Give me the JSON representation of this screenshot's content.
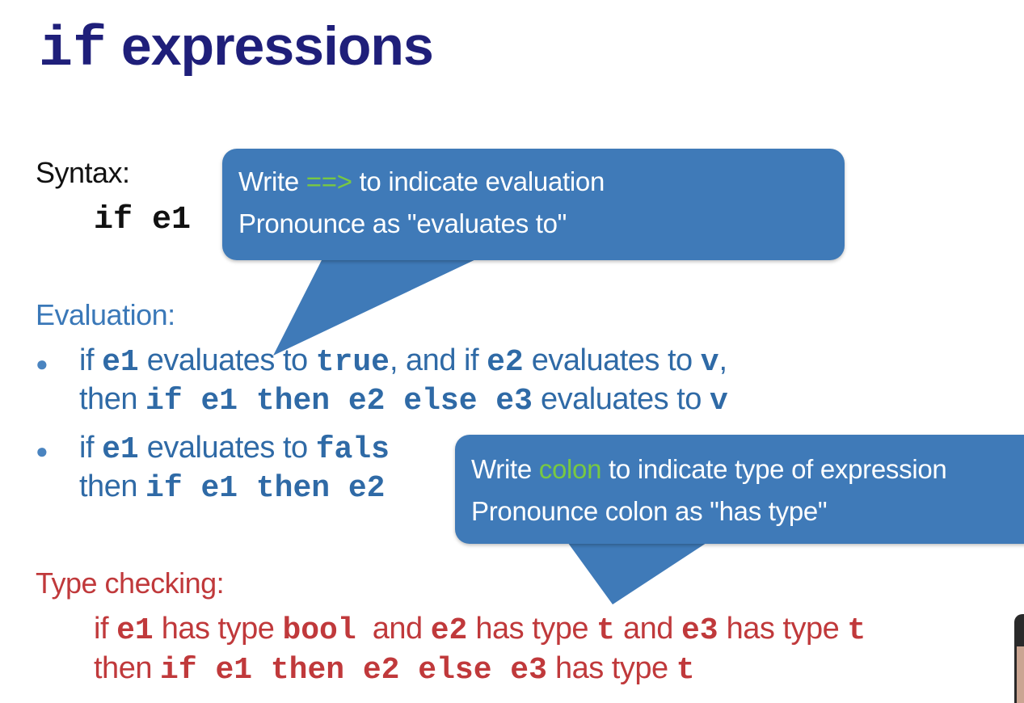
{
  "title": {
    "keyword": "if",
    "rest": " expressions"
  },
  "syntax": {
    "heading": "Syntax:",
    "code": "if e1"
  },
  "evaluation": {
    "heading": "Evaluation:",
    "bullet1": {
      "a1": "if ",
      "c1": "e1",
      "a2": " evaluates to ",
      "c2": "true",
      "a3": ", and if ",
      "c3": "e2",
      "a4": " evaluates to ",
      "c4": "v",
      "a5": ",",
      "b1": "then ",
      "d1": "if e1 then e2 else e3",
      "b2": " evaluates to ",
      "d2": "v"
    },
    "bullet2": {
      "a1": "if ",
      "c1": "e1",
      "a2": " evaluates to ",
      "c2": "fals",
      "b1": "then ",
      "d1": "if e1 then e2"
    }
  },
  "type_checking": {
    "heading": "Type checking:",
    "line1": {
      "t1": "if ",
      "c1": "e1",
      "t2": " has type ",
      "c2": "bool",
      "t3": "  and ",
      "c3": "e2",
      "t4": " has type ",
      "c4": "t",
      "t5": " and ",
      "c5": "e3",
      "t6": " has type ",
      "c6": "t"
    },
    "line2": {
      "t1": "then ",
      "c1": "if e1 then e2 else e3",
      "t2": " has type ",
      "c2": "t"
    }
  },
  "callout_evaluation": {
    "line1_pre": "Write ",
    "line1_hl": "==>",
    "line1_post": " to indicate evaluation",
    "line2": "Pronounce as \"evaluates to\""
  },
  "callout_type": {
    "line1_pre": "Write ",
    "line1_hl": "colon",
    "line1_post": " to indicate type of expression",
    "line2": "Pronounce colon as \"has type\""
  },
  "colors": {
    "title": "#1f1f7a",
    "evaluation": "#2f6aa6",
    "type_checking": "#c0393b",
    "callout_bg": "#3f7ab8",
    "callout_highlight": "#78c842"
  }
}
